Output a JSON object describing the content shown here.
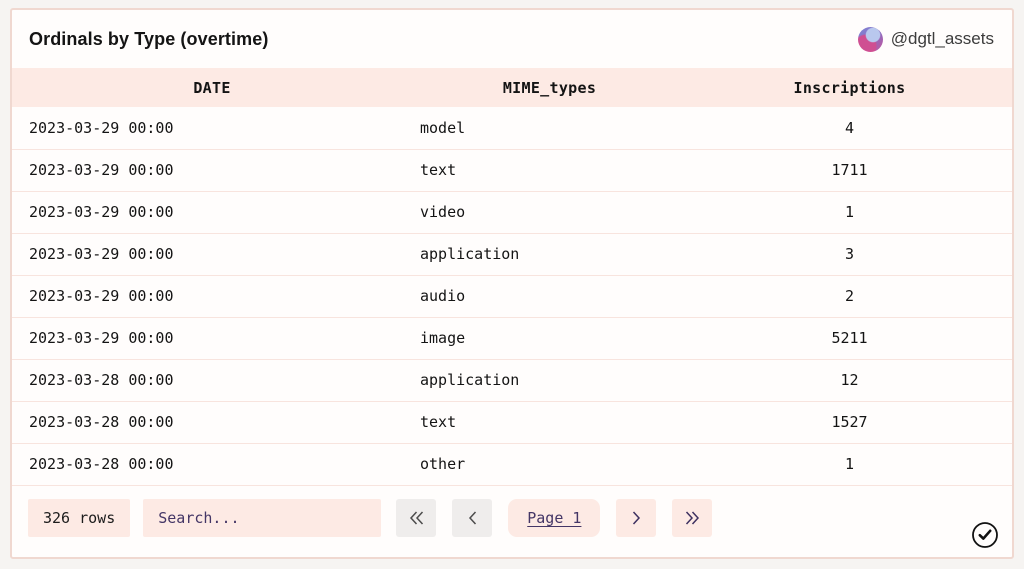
{
  "header": {
    "title": "Ordinals by Type (overtime)",
    "handle": "@dgtl_assets",
    "avatar_icon": "user-avatar"
  },
  "table": {
    "columns": [
      "DATE",
      "MIME_types",
      "Inscriptions"
    ],
    "rows": [
      {
        "date": "2023-03-29 00:00",
        "mime": "model",
        "inscriptions": "4"
      },
      {
        "date": "2023-03-29 00:00",
        "mime": "text",
        "inscriptions": "1711"
      },
      {
        "date": "2023-03-29 00:00",
        "mime": "video",
        "inscriptions": "1"
      },
      {
        "date": "2023-03-29 00:00",
        "mime": "application",
        "inscriptions": "3"
      },
      {
        "date": "2023-03-29 00:00",
        "mime": "audio",
        "inscriptions": "2"
      },
      {
        "date": "2023-03-29 00:00",
        "mime": "image",
        "inscriptions": "5211"
      },
      {
        "date": "2023-03-28 00:00",
        "mime": "application",
        "inscriptions": "12"
      },
      {
        "date": "2023-03-28 00:00",
        "mime": "text",
        "inscriptions": "1527"
      },
      {
        "date": "2023-03-28 00:00",
        "mime": "other",
        "inscriptions": "1"
      }
    ]
  },
  "footer": {
    "row_count": "326 rows",
    "search_placeholder": "Search...",
    "page_label": "Page 1",
    "icons": {
      "first_page": "double-chevron-left",
      "prev_page": "chevron-left",
      "next_page": "chevron-right",
      "last_page": "double-chevron-right",
      "done": "check-circle"
    }
  },
  "colors": {
    "page_background": "#f6f4f2",
    "card_background": "#fffdfc",
    "card_border": "#f0d8d0",
    "pink_fill": "#fdeae4",
    "row_divider": "#f8e4de",
    "gray_fill": "#efedec",
    "accent_purple": "#443666",
    "text": "#141414"
  }
}
